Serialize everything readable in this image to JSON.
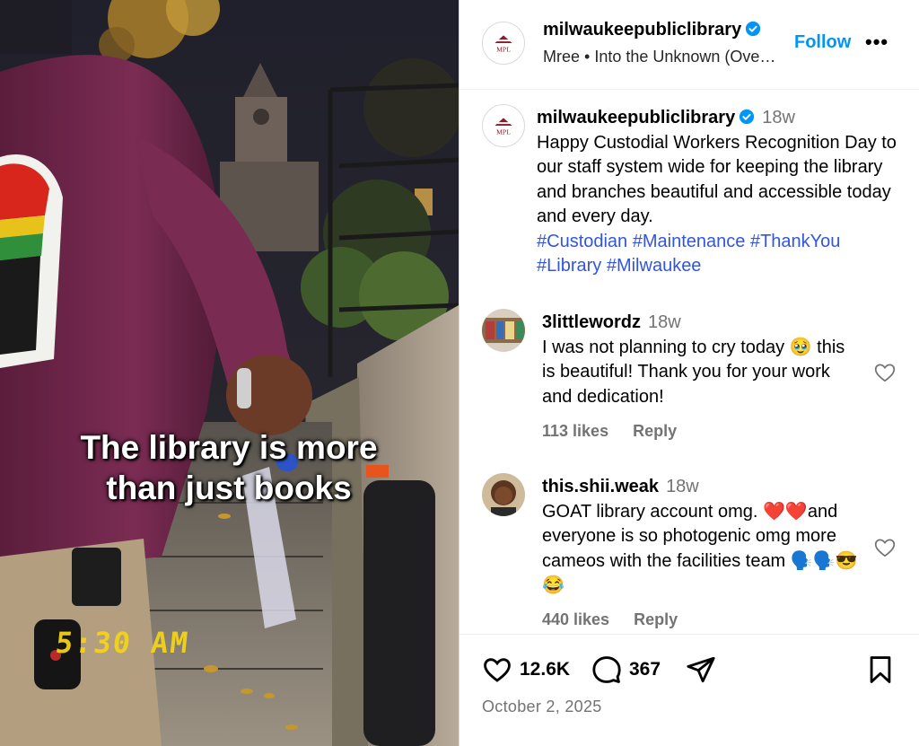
{
  "media": {
    "caption_line1": "The library is more",
    "caption_line2": "than just books",
    "timestamp": "5:30 AM"
  },
  "header": {
    "username": "milwaukeepubliclibrary",
    "verified": true,
    "subline": "Mree • Into the Unknown (Ove…",
    "follow_label": "Follow",
    "more_label": "•••",
    "avatar_text": "MPL"
  },
  "post": {
    "username": "milwaukeepubliclibrary",
    "time": "18w",
    "text": "Happy Custodial Workers Recognition Day to our staff system wide for keeping the library and branches beautiful and accessible today and every day.",
    "hashtags": [
      "#Custodian",
      "#Maintenance",
      "#ThankYou",
      "#Library",
      "#Milwaukee"
    ]
  },
  "comments": [
    {
      "username": "3littlewordz",
      "time": "18w",
      "text": "I was not planning to cry today 🥹 this is beautiful! Thank you for your work and dedication!",
      "likes": "113 likes",
      "reply": "Reply"
    },
    {
      "username": "this.shii.weak",
      "time": "18w",
      "text": "GOAT library account omg. ❤️❤️and everyone is so photogenic omg more cameos with the facilities team 🗣️🗣️😎😂",
      "likes": "440 likes",
      "reply": "Reply"
    }
  ],
  "actions": {
    "likes": "12.6K",
    "comments": "367",
    "date": "October 2, 2025"
  },
  "colors": {
    "link": "#0095f6",
    "hashtag": "#3255e0",
    "muted": "#737373",
    "brand_mpl": "#8a1c2c"
  }
}
